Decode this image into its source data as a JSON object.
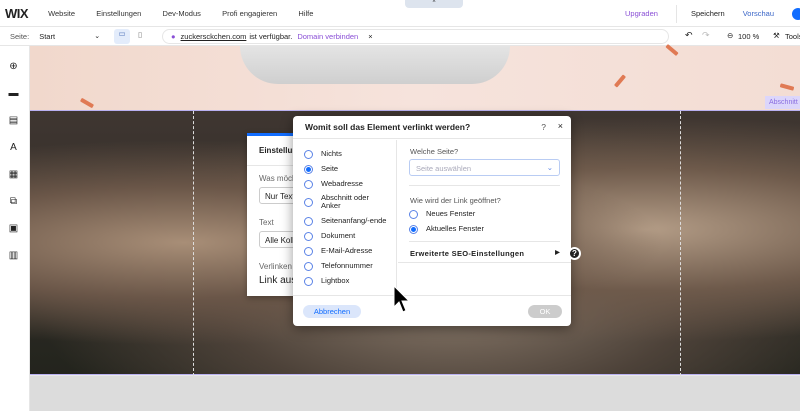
{
  "topbar": {
    "logo": "WIX",
    "menu": [
      "Website",
      "Einstellungen",
      "Dev-Modus",
      "Profi engagieren",
      "Hilfe"
    ],
    "upgrade": "Upgraden",
    "save": "Speichern",
    "preview": "Vorschau"
  },
  "toolbar": {
    "page_label": "Seite:",
    "page_value": "Start",
    "domain": "zuckersckchen.com",
    "domain_suffix": "ist verfügbar.",
    "domain_link": "Domain verbinden",
    "zoom": "100 %",
    "tools": "Tools"
  },
  "canvas": {
    "section_label": "Abschnitt"
  },
  "settings_panel": {
    "title": "Einstellungen",
    "question": "Was möchten Sie anzeigen?",
    "field1": "Nur Text",
    "text_label": "Text",
    "field2": "Alle Kollektionen",
    "link_label": "Verlinken mit",
    "link_value": "Link auswählen"
  },
  "dialog": {
    "title": "Womit soll das Element verlinkt werden?",
    "help": "?",
    "close": "×",
    "options": [
      "Nichts",
      "Seite",
      "Webadresse",
      "Abschnitt oder Anker",
      "Seitenanfang/-ende",
      "Dokument",
      "E-Mail-Adresse",
      "Telefonnummer",
      "Lightbox"
    ],
    "selected_option": "Seite",
    "page_label": "Welche Seite?",
    "page_placeholder": "Seite auswählen",
    "open_label": "Wie wird der Link geöffnet?",
    "open_options": [
      "Neues Fenster",
      "Aktuelles Fenster"
    ],
    "open_selected": "Aktuelles Fenster",
    "seo": "Erweiterte SEO-Einstellungen",
    "cancel": "Abbrechen",
    "ok": "OK"
  }
}
